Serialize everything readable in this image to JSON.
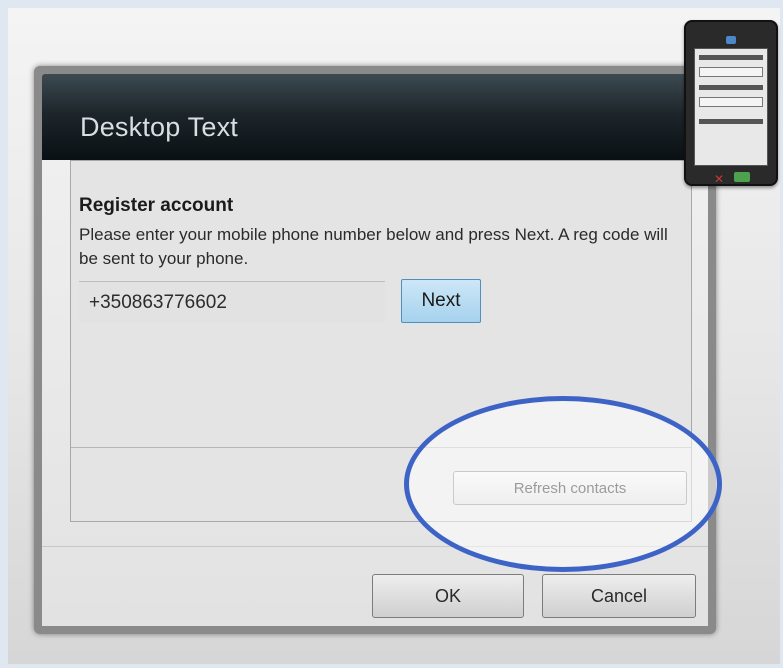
{
  "window": {
    "title": "Desktop Text"
  },
  "register": {
    "heading": "Register account",
    "description": "Please enter your mobile phone number below and press Next. A reg code will be sent to your phone.",
    "phone_value": "+350863776602",
    "next_label": "Next"
  },
  "actions": {
    "refresh_label": "Refresh contacts",
    "ok_label": "OK",
    "cancel_label": "Cancel"
  },
  "annotation": {
    "highlight_color": "#3d63c7",
    "highlight_shape": "ellipse"
  },
  "icons": {
    "thumbnail": "phone-thumbnail-icon"
  }
}
